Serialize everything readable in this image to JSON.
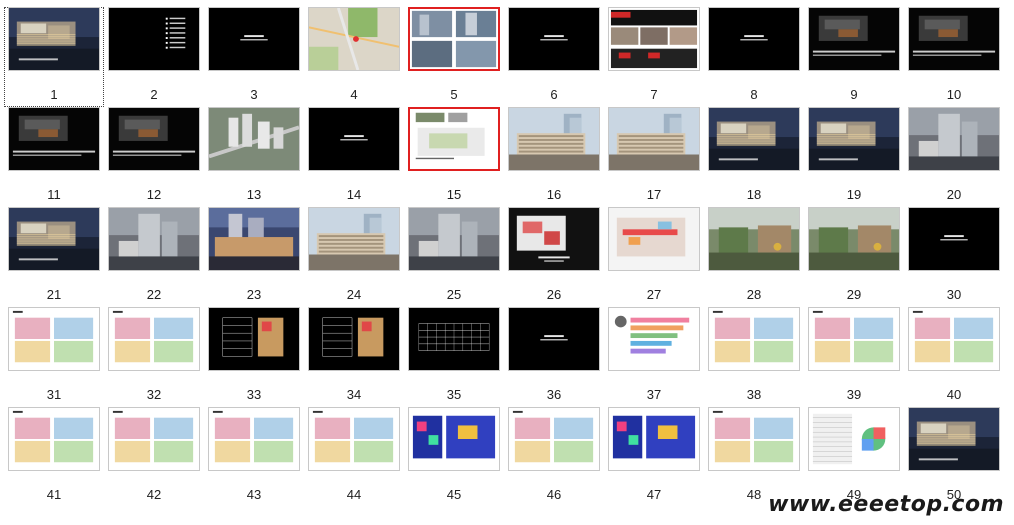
{
  "slides": [
    {
      "num": "1",
      "style": "photo-night",
      "selected": true
    },
    {
      "num": "2",
      "style": "dark-list"
    },
    {
      "num": "3",
      "style": "dark-title"
    },
    {
      "num": "4",
      "style": "map"
    },
    {
      "num": "5",
      "style": "photo-grid",
      "red": true
    },
    {
      "num": "6",
      "style": "dark-title"
    },
    {
      "num": "7",
      "style": "collage"
    },
    {
      "num": "8",
      "style": "dark-title"
    },
    {
      "num": "9",
      "style": "dark-render"
    },
    {
      "num": "10",
      "style": "dark-render"
    },
    {
      "num": "11",
      "style": "dark-render"
    },
    {
      "num": "12",
      "style": "dark-render"
    },
    {
      "num": "13",
      "style": "aerial"
    },
    {
      "num": "14",
      "style": "dark-title"
    },
    {
      "num": "15",
      "style": "white-diagram",
      "red": true
    },
    {
      "num": "16",
      "style": "photo-day"
    },
    {
      "num": "17",
      "style": "photo-day"
    },
    {
      "num": "18",
      "style": "photo-night"
    },
    {
      "num": "19",
      "style": "photo-night"
    },
    {
      "num": "20",
      "style": "photo-gray"
    },
    {
      "num": "21",
      "style": "photo-night"
    },
    {
      "num": "22",
      "style": "photo-gray"
    },
    {
      "num": "23",
      "style": "photo-dusk"
    },
    {
      "num": "24",
      "style": "photo-day"
    },
    {
      "num": "25",
      "style": "photo-gray"
    },
    {
      "num": "26",
      "style": "dark-plan"
    },
    {
      "num": "27",
      "style": "plan-color"
    },
    {
      "num": "28",
      "style": "photo-green"
    },
    {
      "num": "29",
      "style": "photo-green"
    },
    {
      "num": "30",
      "style": "dark-title"
    },
    {
      "num": "31",
      "style": "white-plans"
    },
    {
      "num": "32",
      "style": "white-plans"
    },
    {
      "num": "33",
      "style": "dark-section"
    },
    {
      "num": "34",
      "style": "dark-section"
    },
    {
      "num": "35",
      "style": "dark-lines"
    },
    {
      "num": "36",
      "style": "dark-title"
    },
    {
      "num": "37",
      "style": "white-chart"
    },
    {
      "num": "38",
      "style": "white-plans"
    },
    {
      "num": "39",
      "style": "white-plans"
    },
    {
      "num": "40",
      "style": "white-plans"
    },
    {
      "num": "41",
      "style": "white-plans"
    },
    {
      "num": "42",
      "style": "white-plans"
    },
    {
      "num": "43",
      "style": "white-plans"
    },
    {
      "num": "44",
      "style": "white-plans"
    },
    {
      "num": "45",
      "style": "white-colorful"
    },
    {
      "num": "46",
      "style": "white-plans"
    },
    {
      "num": "47",
      "style": "white-colorful"
    },
    {
      "num": "48",
      "style": "white-plans"
    },
    {
      "num": "49",
      "style": "white-pie"
    },
    {
      "num": "50",
      "style": "photo-night"
    }
  ],
  "watermark": "www.eeeetop.com",
  "colors": {
    "selection": "#444444",
    "red_border": "#e02020",
    "dark": "#000000"
  }
}
